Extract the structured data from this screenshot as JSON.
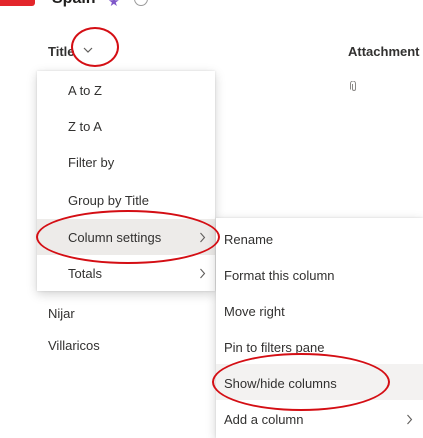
{
  "header": {
    "list_title": "Spain",
    "star_icon": "star-icon",
    "info_icon": "info-icon",
    "accent_color": "#e3262b"
  },
  "columns": {
    "title_label": "Title",
    "attachments_label": "Attachment"
  },
  "rows": [
    {
      "title": "Nijar"
    },
    {
      "title": "Villaricos"
    }
  ],
  "column_menu": {
    "items": [
      {
        "label": "A to Z",
        "has_submenu": false
      },
      {
        "label": "Z to A",
        "has_submenu": false
      },
      {
        "label": "Filter by",
        "has_submenu": false
      },
      {
        "label": "Group by Title",
        "has_submenu": false
      },
      {
        "label": "Column settings",
        "has_submenu": true,
        "active": true
      },
      {
        "label": "Totals",
        "has_submenu": true
      }
    ]
  },
  "column_settings_submenu": {
    "items": [
      {
        "label": "Rename",
        "has_submenu": false
      },
      {
        "label": "Format this column",
        "has_submenu": false
      },
      {
        "label": "Move right",
        "has_submenu": false
      },
      {
        "label": "Pin to filters pane",
        "has_submenu": false
      },
      {
        "label": "Show/hide columns",
        "has_submenu": false,
        "hover": true
      },
      {
        "label": "Add a column",
        "has_submenu": true
      }
    ]
  },
  "annotation_color": "#d40e14"
}
